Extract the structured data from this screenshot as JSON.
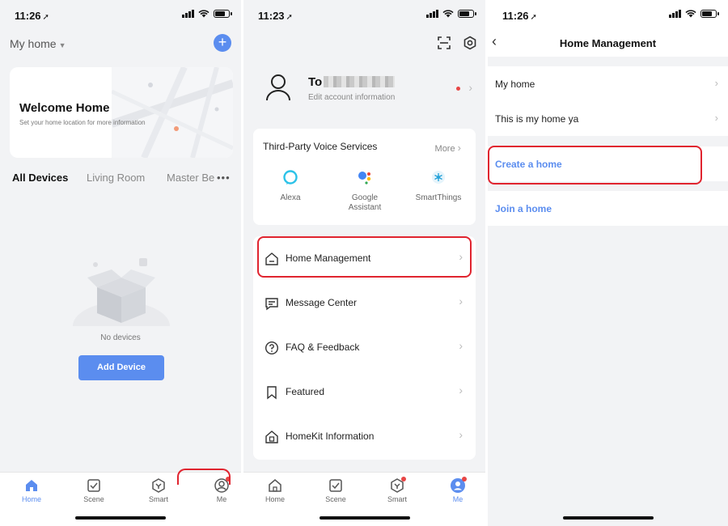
{
  "panel1": {
    "status_time": "11:26",
    "home_selector": "My home",
    "welcome_title": "Welcome Home",
    "welcome_sub": "Set your home location for more information",
    "rooms": [
      "All Devices",
      "Living Room",
      "Master Be"
    ],
    "rooms_more": "•••",
    "empty_text": "No devices",
    "add_device_label": "Add Device",
    "tabs": [
      "Home",
      "Scene",
      "Smart",
      "Me"
    ]
  },
  "panel2": {
    "status_time": "11:23",
    "account_name": "To",
    "account_sub": "Edit account information",
    "voice_header": "Third-Party Voice Services",
    "voice_more": "More",
    "services": [
      "Alexa",
      "Google",
      "Assistant",
      "SmartThings"
    ],
    "menu": [
      "Home Management",
      "Message Center",
      "FAQ & Feedback",
      "Featured",
      "HomeKit Information"
    ],
    "tabs": [
      "Home",
      "Scene",
      "Smart",
      "Me"
    ]
  },
  "panel3": {
    "status_time": "11:26",
    "nav_title": "Home Management",
    "homes": [
      "My home",
      "This is my home ya"
    ],
    "create_label": "Create a home",
    "join_label": "Join a home"
  },
  "colors": {
    "accent": "#5b8def",
    "highlight": "#e0242f",
    "background": "#f2f3f5"
  }
}
